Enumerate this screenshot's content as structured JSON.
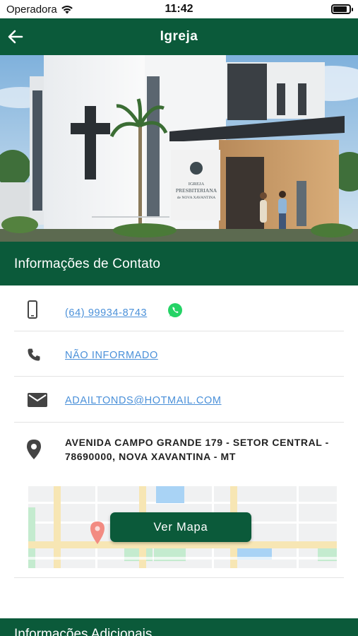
{
  "status_bar": {
    "carrier": "Operadora",
    "time": "11:42",
    "battery_level": 0.85
  },
  "header": {
    "title": "Igreja",
    "back_icon": "arrow-left-icon"
  },
  "hero": {
    "sign_line1": "IGREJA",
    "sign_line2": "PRESBITERIANA",
    "sign_line3": "de NOVA XAVANTINA"
  },
  "contact": {
    "section_title": "Informações de Contato",
    "mobile": "(64) 99934-8743",
    "mobile_icon": "smartphone-icon",
    "whatsapp_icon": "whatsapp-icon",
    "phone": "NÃO INFORMADO",
    "phone_icon": "phone-icon",
    "email": "ADAILTONDS@HOTMAIL.COM",
    "email_icon": "envelope-icon",
    "address": "AVENIDA CAMPO GRANDE 179 - SETOR CENTRAL - 78690000, NOVA XAVANTINA - MT",
    "address_icon": "map-pin-icon",
    "map_button": "Ver Mapa"
  },
  "additional": {
    "section_title": "Informações Adicionais"
  },
  "colors": {
    "brand_green": "#0b5a3a",
    "link_blue": "#4a90d9",
    "whatsapp_green": "#25d366"
  }
}
